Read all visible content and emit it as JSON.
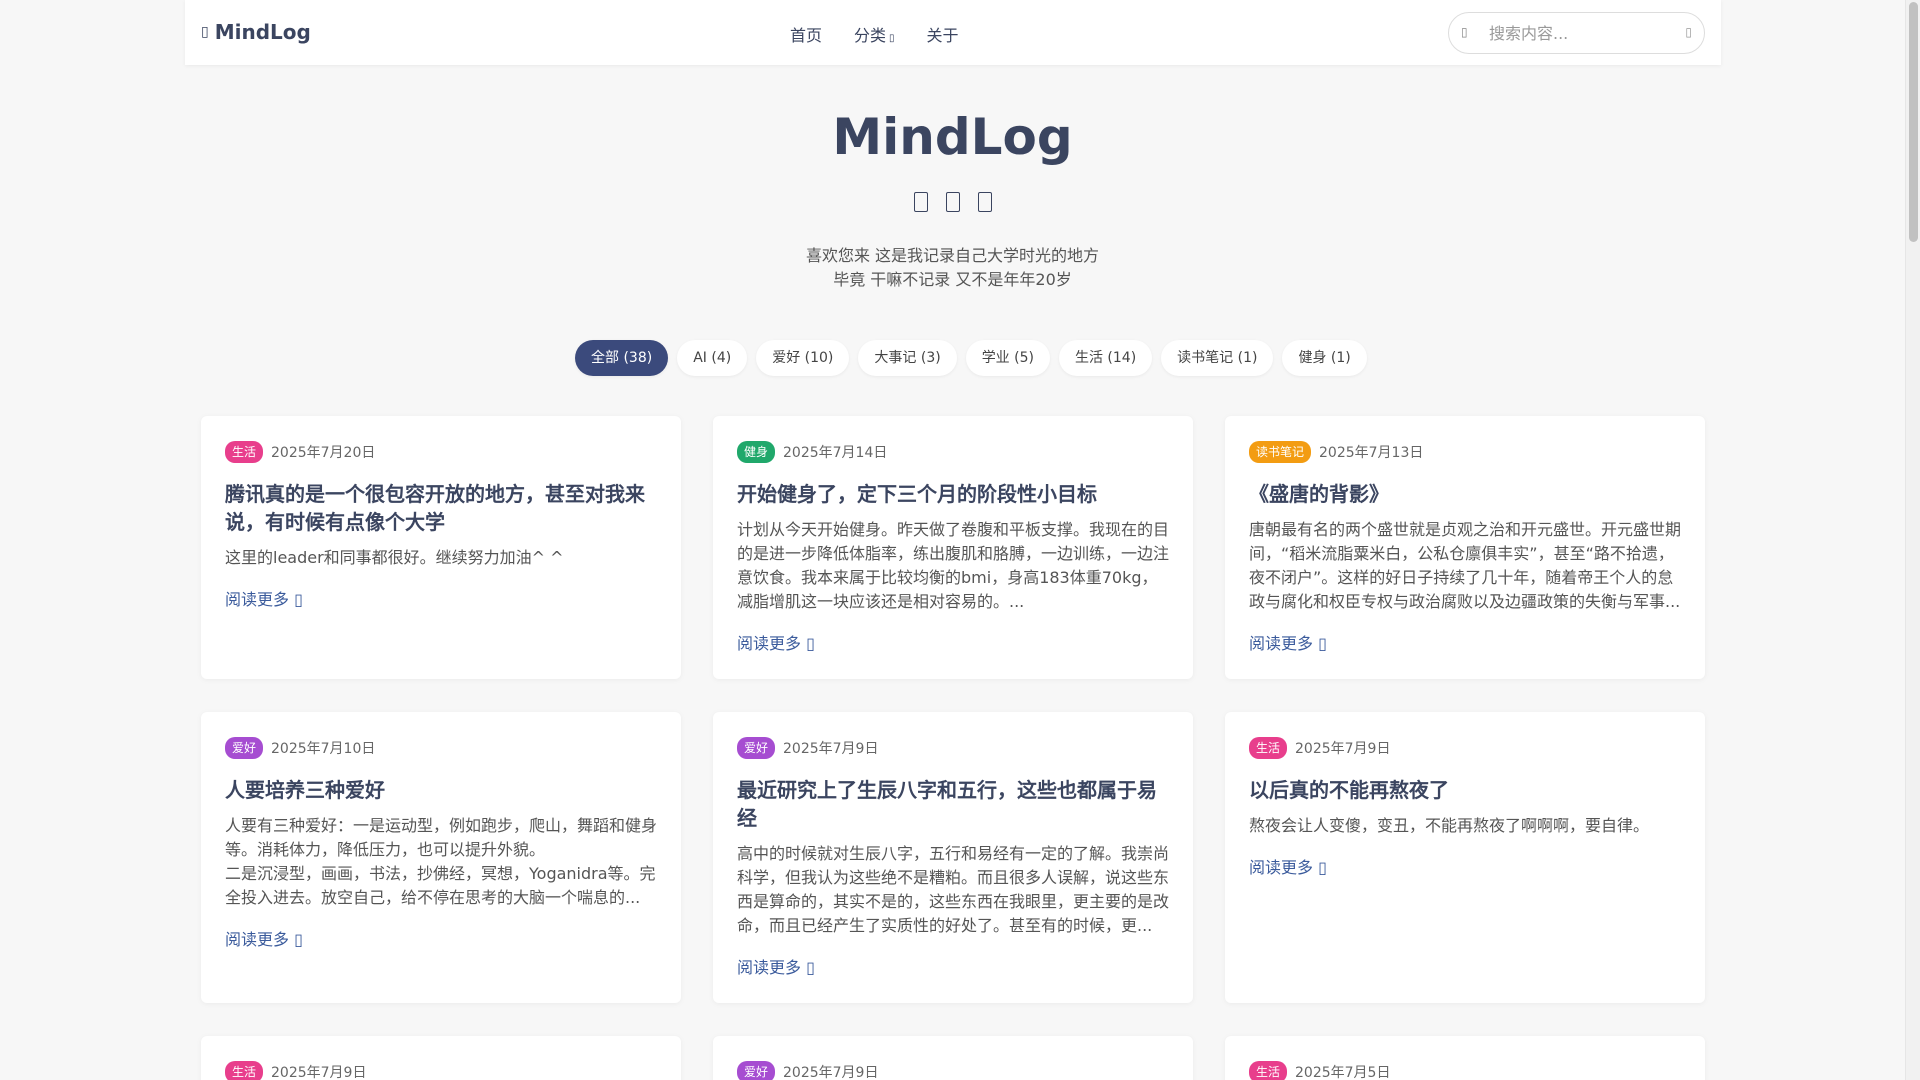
{
  "nav": {
    "brand": "MindLog",
    "links": [
      "首页",
      "分类",
      "关于"
    ],
    "search_placeholder": "搜索内容..."
  },
  "hero": {
    "title": "MindLog",
    "tagline_1": "喜欢您来 这是我记录自己大学时光的地方",
    "tagline_2": "毕竟 干嘛不记录 又不是年年20岁"
  },
  "filters": [
    "全部 (38)",
    "AI (4)",
    "爱好 (10)",
    "大事记 (3)",
    "学业 (5)",
    "生活 (14)",
    "读书笔记 (1)",
    "健身 (1)"
  ],
  "read_more": "阅读更多",
  "colors": {
    "生活": "#e83e8c",
    "健身": "#20a86b",
    "读书笔记": "#f39c12",
    "爱好": "#a64dd1",
    "primary": "#3b4a7c"
  },
  "posts": [
    {
      "category": "生活",
      "date": "2025年7月20日",
      "title": "腾讯真的是一个很包容开放的地方，甚至对我来说，有时候有点像个大学",
      "excerpt": "这里的leader和同事都很好。继续努力加油^ ^"
    },
    {
      "category": "健身",
      "date": "2025年7月14日",
      "title": "开始健身了，定下三个月的阶段性小目标",
      "excerpt": "计划从今天开始健身。昨天做了卷腹和平板支撑。我现在的目的是进一步降低体脂率，练出腹肌和胳膊，一边训练，一边注意饮食。我本来属于比较均衡的bmi，身高183体重70kg，减脂增肌这一块应该还是相对容易的。..."
    },
    {
      "category": "读书笔记",
      "date": "2025年7月13日",
      "title": "《盛唐的背影》",
      "excerpt": "唐朝最有名的两个盛世就是贞观之治和开元盛世。开元盛世期间，“稻米流脂粟米白，公私仓廪俱丰实”，甚至“路不拾遗，夜不闭户”。这样的好日子持续了几十年，随着帝王个人的怠政与腐化和权臣专权与政治腐败以及边疆政策的失衡与军事..."
    },
    {
      "category": "爱好",
      "date": "2025年7月10日",
      "title": "人要培养三种爱好",
      "excerpt": "人要有三种爱好：一是运动型，例如跑步，爬山，舞蹈和健身等。消耗体力，降低压力，也可以提升外貌。\n二是沉浸型，画画，书法，抄佛经，冥想，Yoganidra等。完全投入进去。放空自己，给不停在思考的大脑一个喘息的..."
    },
    {
      "category": "爱好",
      "date": "2025年7月9日",
      "title": "最近研究上了生辰八字和五行，这些也都属于易经",
      "excerpt": "高中的时候就对生辰八字，五行和易经有一定的了解。我崇尚科学，但我认为这些绝不是糟粕。而且很多人误解，说这些东西是算命的，其实不是的，这些东西在我眼里，更主要的是改命，而且已经产生了实质性的好处了。甚至有的时候，更..."
    },
    {
      "category": "生活",
      "date": "2025年7月9日",
      "title": "以后真的不能再熬夜了",
      "excerpt": "熬夜会让人变傻，变丑，不能再熬夜了啊啊啊，要自律。"
    },
    {
      "category": "生活",
      "date": "2025年7月9日"
    },
    {
      "category": "爱好",
      "date": "2025年7月9日"
    },
    {
      "category": "生活",
      "date": "2025年7月5日"
    }
  ]
}
